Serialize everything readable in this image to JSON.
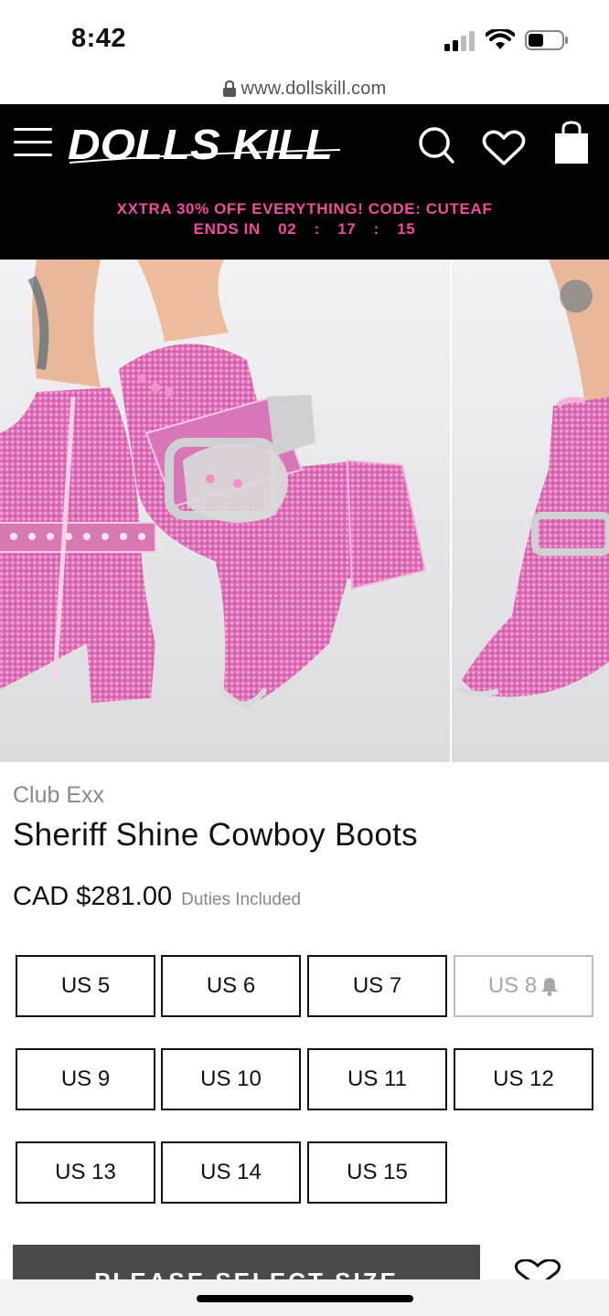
{
  "status_bar": {
    "time": "8:42"
  },
  "browser": {
    "url": "www.dollskill.com"
  },
  "header": {
    "logo_text": "DOLLS KILL",
    "promo_line": "XXTRA 30% OFF EVERYTHING! CODE: CUTEAF",
    "countdown_label": "ENDS IN",
    "countdown": {
      "hours": "02",
      "minutes": "17",
      "seconds": "15",
      "separator": ":"
    }
  },
  "product": {
    "brand": "Club Exx",
    "title": "Sheriff Shine Cowboy Boots",
    "price": "CAD $281.00",
    "price_note": "Duties Included",
    "image_slide": 1
  },
  "sizes": [
    {
      "label": "US 5",
      "available": true
    },
    {
      "label": "US 6",
      "available": true
    },
    {
      "label": "US 7",
      "available": true
    },
    {
      "label": "US 8",
      "available": false
    },
    {
      "label": "US 9",
      "available": true
    },
    {
      "label": "US 10",
      "available": true
    },
    {
      "label": "US 11",
      "available": true
    },
    {
      "label": "US 12",
      "available": true
    },
    {
      "label": "US 13",
      "available": true
    },
    {
      "label": "US 14",
      "available": true
    },
    {
      "label": "US 15",
      "available": true
    }
  ],
  "cta": {
    "label": "PLEASE SELECT SIZE"
  },
  "icons": {
    "menu": "hamburger-icon",
    "search": "search-icon",
    "wishlist": "heart-icon",
    "cart": "bag-icon",
    "lock": "lock-icon",
    "notify": "bell-icon"
  },
  "colors": {
    "promo": "#ef4ca0",
    "header_bg": "#000000",
    "cta_bg": "#4a4a4a",
    "boot_pink": "#e87cc0"
  }
}
